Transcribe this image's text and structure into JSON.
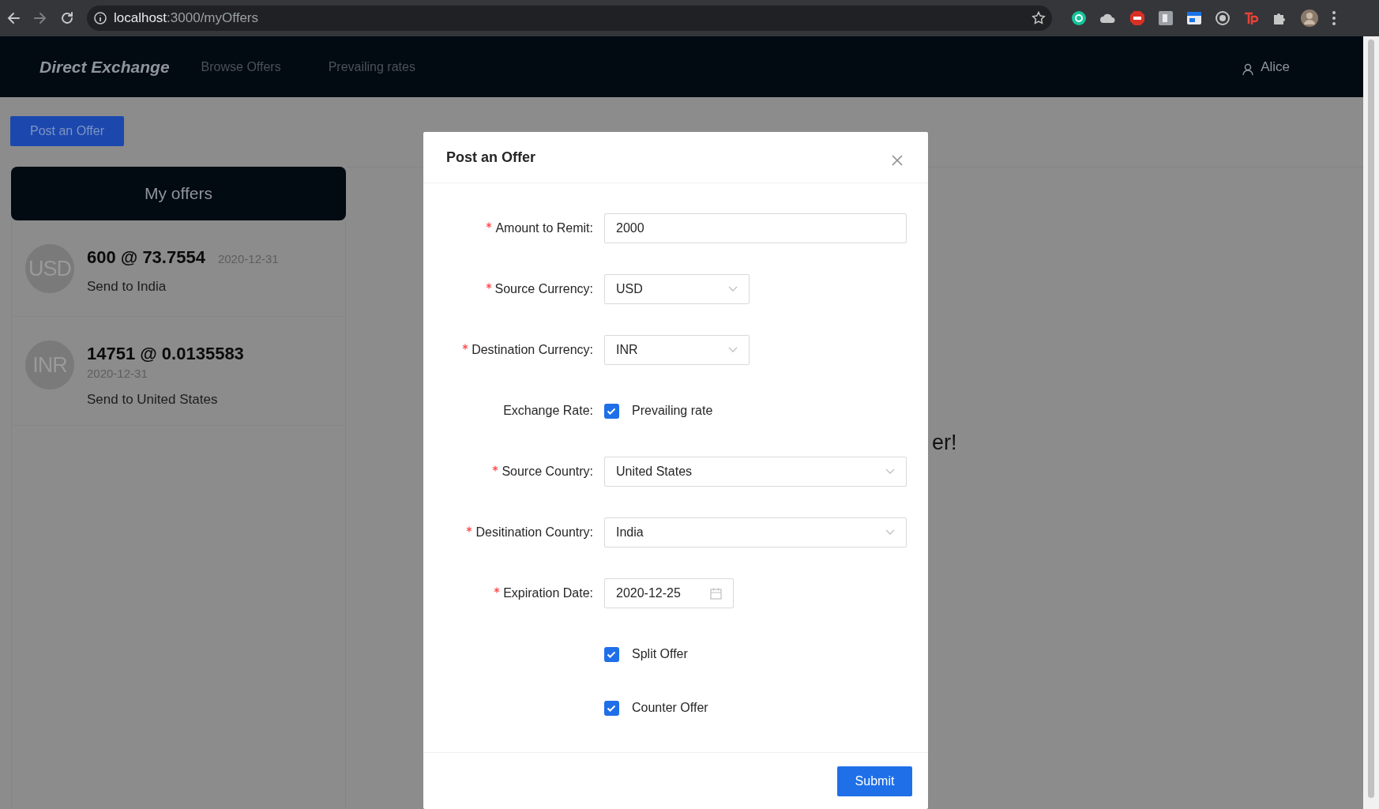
{
  "browser": {
    "url_host": "localhost",
    "url_path": ":3000/myOffers"
  },
  "navbar": {
    "brand": "Direct Exchange",
    "links": [
      {
        "label": "Browse Offers"
      },
      {
        "label": "Prevailing rates"
      }
    ],
    "user": "Alice"
  },
  "post_button": "Post an Offer",
  "offers_panel": {
    "title": "My offers",
    "offers": [
      {
        "kind": "inline-date",
        "avatar": "USD",
        "title": "600 @ 73.7554",
        "date": "2020-12-31",
        "subtitle": "Send to India"
      },
      {
        "kind": "date-below",
        "avatar": "INR",
        "title": "14751 @ 0.0135583",
        "date": "2020-12-31",
        "subtitle": "Send to United States"
      }
    ]
  },
  "background_message": "er!",
  "modal": {
    "title": "Post an Offer",
    "fields": [
      {
        "kind": "input",
        "label": "Amount to Remit:",
        "required": true,
        "value": "2000"
      },
      {
        "kind": "select-short",
        "label": "Source Currency:",
        "required": true,
        "value": "USD"
      },
      {
        "kind": "select-short",
        "label": "Destination Currency:",
        "required": true,
        "value": "INR"
      },
      {
        "kind": "checkbox",
        "label": "Exchange Rate:",
        "required": false,
        "option": "Prevailing rate",
        "checked": true
      },
      {
        "kind": "select",
        "label": "Source Country:",
        "required": true,
        "value": "United States"
      },
      {
        "kind": "select",
        "label": "Desitination Country:",
        "required": true,
        "value": "India"
      },
      {
        "kind": "date",
        "label": "Expiration Date:",
        "required": true,
        "value": "2020-12-25"
      },
      {
        "kind": "checkbox",
        "option": "Split Offer",
        "checked": true
      },
      {
        "kind": "checkbox",
        "option": "Counter Offer",
        "checked": true
      }
    ],
    "submit": "Submit"
  }
}
